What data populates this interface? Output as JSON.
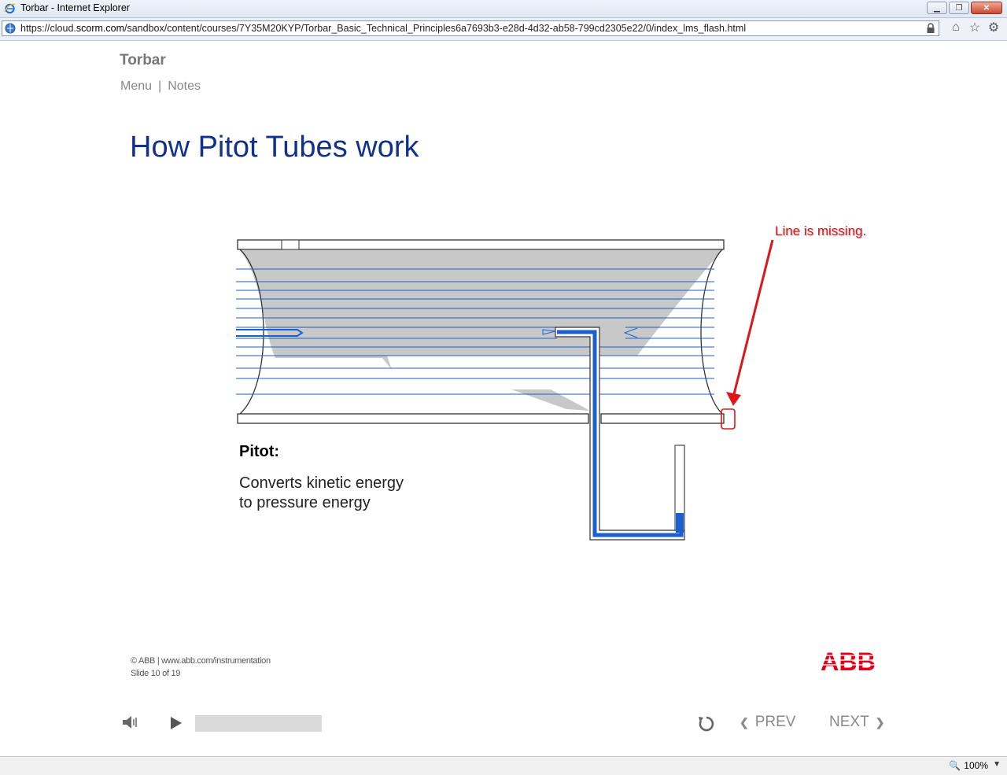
{
  "browser": {
    "title": "Torbar - Internet Explorer",
    "url_prefix": "https://cloud.",
    "url_domain": "scorm.com",
    "url_path": "/sandbox/content/courses/7Y35M20KYP/Torbar_Basic_Technical_Principles6a7693b3-e28d-4d32-ab58-799cd2305e22/0/index_lms_flash.html",
    "zoom_label": "100%"
  },
  "course": {
    "name": "Torbar",
    "nav": {
      "menu": "Menu",
      "separator": "|",
      "notes": "Notes"
    }
  },
  "slide": {
    "title": "How Pitot Tubes work",
    "pitot_heading": "Pitot:",
    "pitot_desc_line1": "Converts kinetic energy",
    "pitot_desc_line2": "to pressure energy",
    "annotation": "Line is missing.",
    "copyright": "© ABB | www.abb.com/instrumentation",
    "slide_count": "Slide 10 of 19",
    "logo_text": "ABB"
  },
  "player": {
    "progress_fraction": 0.0,
    "prev_label": "PREV",
    "next_label": "NEXT"
  },
  "colors": {
    "title_blue": "#10328c",
    "flow_line_blue": "#1a5fd0",
    "annotation_red": "#e0151a",
    "abb_red": "#e2001a"
  }
}
